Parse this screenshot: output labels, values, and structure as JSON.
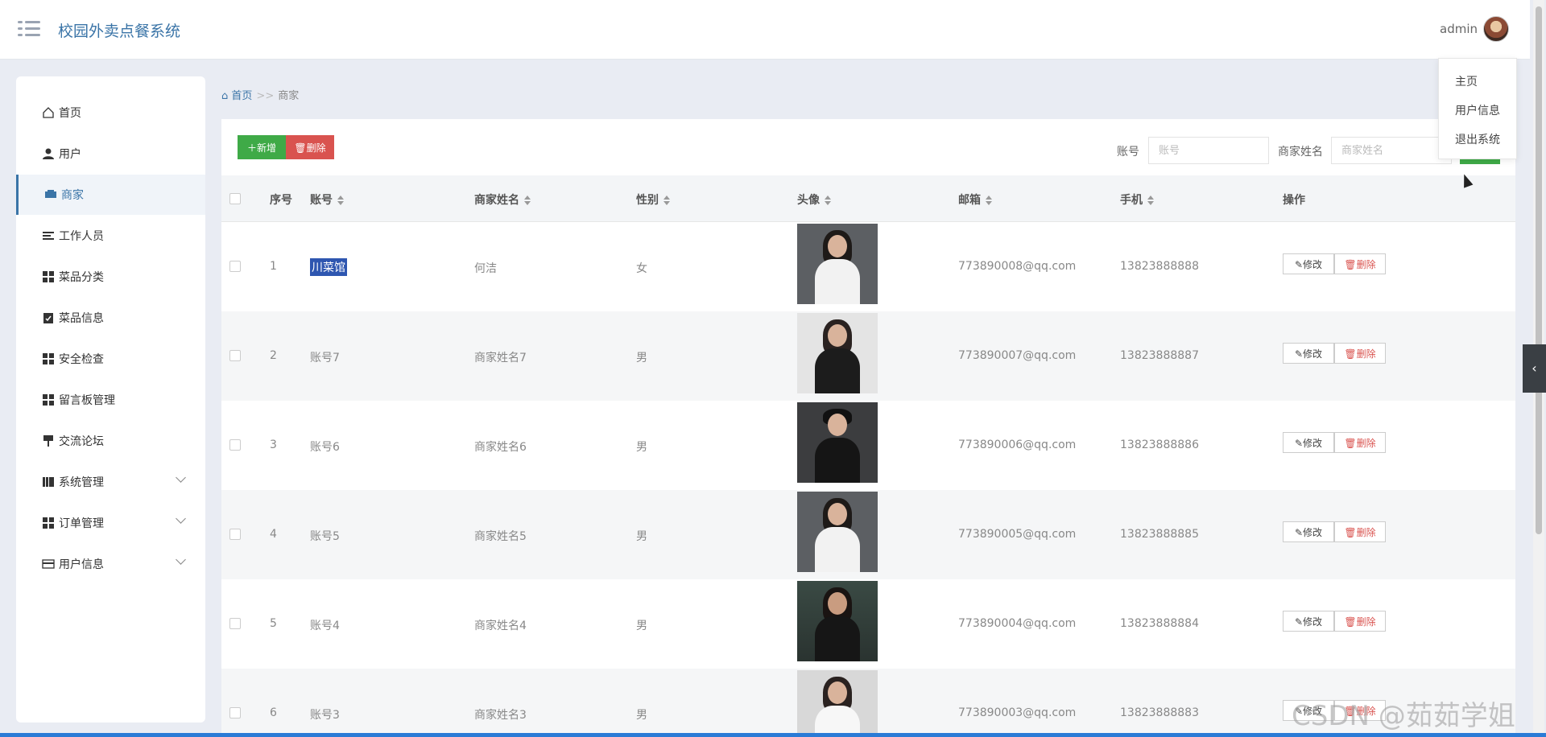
{
  "header": {
    "title": "校园外卖点餐系统",
    "user": "admin"
  },
  "user_menu": [
    "主页",
    "用户信息",
    "退出系统"
  ],
  "sidebar": {
    "items": [
      {
        "label": "首页",
        "icon": "home-icon"
      },
      {
        "label": "用户",
        "icon": "user-icon"
      },
      {
        "label": "商家",
        "icon": "merchant-icon",
        "active": true
      },
      {
        "label": "工作人员",
        "icon": "list-icon"
      },
      {
        "label": "菜品分类",
        "icon": "grid-icon"
      },
      {
        "label": "菜品信息",
        "icon": "clipboard-icon"
      },
      {
        "label": "安全检查",
        "icon": "grid-icon"
      },
      {
        "label": "留言板管理",
        "icon": "grid-icon"
      },
      {
        "label": "交流论坛",
        "icon": "pin-icon"
      },
      {
        "label": "系统管理",
        "icon": "book-icon",
        "expandable": true
      },
      {
        "label": "订单管理",
        "icon": "grid-icon",
        "expandable": true
      },
      {
        "label": "用户信息",
        "icon": "card-icon",
        "expandable": true
      }
    ]
  },
  "breadcrumb": {
    "home": "首页",
    "sep": ">>",
    "current": "商家"
  },
  "toolbar": {
    "add_label": "新增",
    "delete_label": "删除",
    "account_label": "账号",
    "account_placeholder": "账号",
    "name_label": "商家姓名",
    "name_placeholder": "商家姓名"
  },
  "table": {
    "columns": [
      "序号",
      "账号",
      "商家姓名",
      "性别",
      "头像",
      "邮箱",
      "手机",
      "操作"
    ],
    "rows": [
      {
        "no": "1",
        "account": "川菜馆",
        "name": "何洁",
        "gender": "女",
        "email": "773890008@qq.com",
        "phone": "13823888888"
      },
      {
        "no": "2",
        "account": "账号7",
        "name": "商家姓名7",
        "gender": "男",
        "email": "773890007@qq.com",
        "phone": "13823888887"
      },
      {
        "no": "3",
        "account": "账号6",
        "name": "商家姓名6",
        "gender": "男",
        "email": "773890006@qq.com",
        "phone": "13823888886"
      },
      {
        "no": "4",
        "account": "账号5",
        "name": "商家姓名5",
        "gender": "男",
        "email": "773890005@qq.com",
        "phone": "13823888885"
      },
      {
        "no": "5",
        "account": "账号4",
        "name": "商家姓名4",
        "gender": "男",
        "email": "773890004@qq.com",
        "phone": "13823888884"
      },
      {
        "no": "6",
        "account": "账号3",
        "name": "商家姓名3",
        "gender": "男",
        "email": "773890003@qq.com",
        "phone": "13823888883"
      }
    ],
    "edit_label": "修改",
    "delete_label": "删除"
  },
  "watermark": "CSDN @茹茹学姐",
  "colors": {
    "accent": "#3a74a7",
    "add": "#3faa47",
    "danger": "#d9534f"
  }
}
